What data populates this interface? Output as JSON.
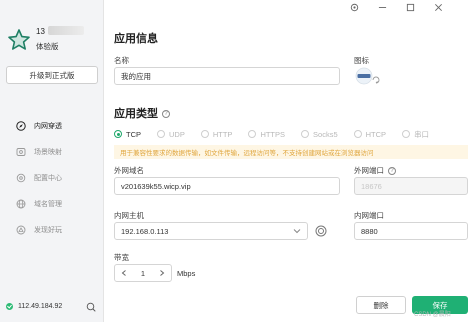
{
  "window": {
    "controls": [
      "settings-icon",
      "minimize-icon",
      "maximize-icon",
      "close-icon"
    ]
  },
  "sidebar": {
    "user": {
      "name_prefix": "13",
      "version": "体验版"
    },
    "upgrade_label": "升级到正式版",
    "items": [
      {
        "label": "内网穿透",
        "icon": "compass-icon",
        "active": true
      },
      {
        "label": "场景映射",
        "icon": "scene-icon",
        "active": false
      },
      {
        "label": "配置中心",
        "icon": "settings-icon",
        "active": false
      },
      {
        "label": "域名管理",
        "icon": "globe-icon",
        "active": false
      },
      {
        "label": "发现好玩",
        "icon": "discover-icon",
        "active": false
      }
    ],
    "ip": "112.49.184.92"
  },
  "app_info": {
    "title": "应用信息",
    "name_label": "名称",
    "name_value": "我的应用",
    "icon_label": "图标"
  },
  "app_type": {
    "title": "应用类型",
    "options": [
      {
        "label": "TCP",
        "selected": true
      },
      {
        "label": "UDP",
        "selected": false
      },
      {
        "label": "HTTP",
        "selected": false
      },
      {
        "label": "HTTPS",
        "selected": false
      },
      {
        "label": "Socks5",
        "selected": false
      },
      {
        "label": "HTCP",
        "selected": false
      },
      {
        "label": "串口",
        "selected": false
      }
    ],
    "notice": "用于兼容性要求的数据传输，如文件传输，远程访问等，不支持创建网站或在浏览器访问"
  },
  "form": {
    "external_domain_label": "外网域名",
    "external_domain_value": "v201639k55.wicp.vip",
    "external_port_label": "外网端口",
    "external_port_value": "18676",
    "internal_host_label": "内网主机",
    "internal_host_value": "192.168.0.113",
    "internal_port_label": "内网端口",
    "internal_port_value": "8880",
    "bandwidth_label": "带宽",
    "bandwidth_value": "1",
    "bandwidth_unit": "Mbps"
  },
  "actions": {
    "delete_label": "删除",
    "save_label": "保存"
  },
  "watermark": "CSDN @晨阳",
  "colors": {
    "accent": "#1fb074",
    "notice_bg": "#fef6e4",
    "notice_text": "#e0a63e"
  }
}
